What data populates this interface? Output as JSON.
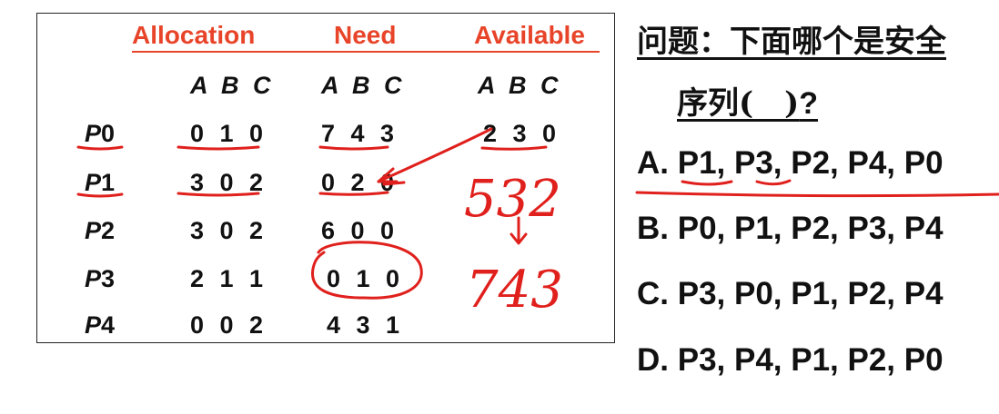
{
  "table": {
    "headers": {
      "allocation": "Allocation",
      "need": "Need",
      "available": "Available"
    },
    "abc": "A B C",
    "rows": [
      {
        "proc_prefix": "P",
        "proc_num": "0",
        "allocation": "0 1 0",
        "need": "7 4 3",
        "available": "2 3 0"
      },
      {
        "proc_prefix": "P",
        "proc_num": "1",
        "allocation": "3 0 2",
        "need": "0 2 0"
      },
      {
        "proc_prefix": "P",
        "proc_num": "2",
        "allocation": "3 0 2",
        "need": "6 0 0"
      },
      {
        "proc_prefix": "P",
        "proc_num": "3",
        "allocation": "2 1 1",
        "need": "0 1 0"
      },
      {
        "proc_prefix": "P",
        "proc_num": "4",
        "allocation": "0 0 2",
        "need": "4 3 1"
      }
    ]
  },
  "handwriting": {
    "value1": "532",
    "arrow": "↓",
    "value2": "743",
    "color": "#e0201c"
  },
  "question": {
    "line1": "问题：下面哪个是安全",
    "line2_text": "序列(　)",
    "line2_mark": "?",
    "options": [
      "A. P1, P3, P2, P4, P0",
      "B. P0, P1, P2, P3, P4",
      "C. P3, P0, P1, P2, P4",
      "D. P3, P4, P1, P2, P0"
    ]
  },
  "colors": {
    "header": "#e8442a",
    "text": "#111111",
    "ink": "#e0201c"
  }
}
